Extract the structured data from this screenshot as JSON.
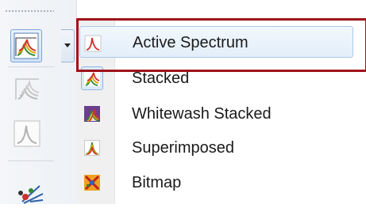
{
  "menu": {
    "items": [
      {
        "label": "Active Spectrum",
        "icon": "active-spectrum-icon",
        "highlighted": true
      },
      {
        "label": "Stacked",
        "icon": "stacked-icon",
        "checked": true
      },
      {
        "label": "Whitewash Stacked",
        "icon": "whitewash-stacked-icon"
      },
      {
        "label": "Superimposed",
        "icon": "superimposed-icon"
      },
      {
        "label": "Bitmap",
        "icon": "bitmap-icon"
      }
    ]
  },
  "colors": {
    "annotation": "#a0121a",
    "highlight_border": "#a9c9ee",
    "peak_red": "#d0312d"
  }
}
